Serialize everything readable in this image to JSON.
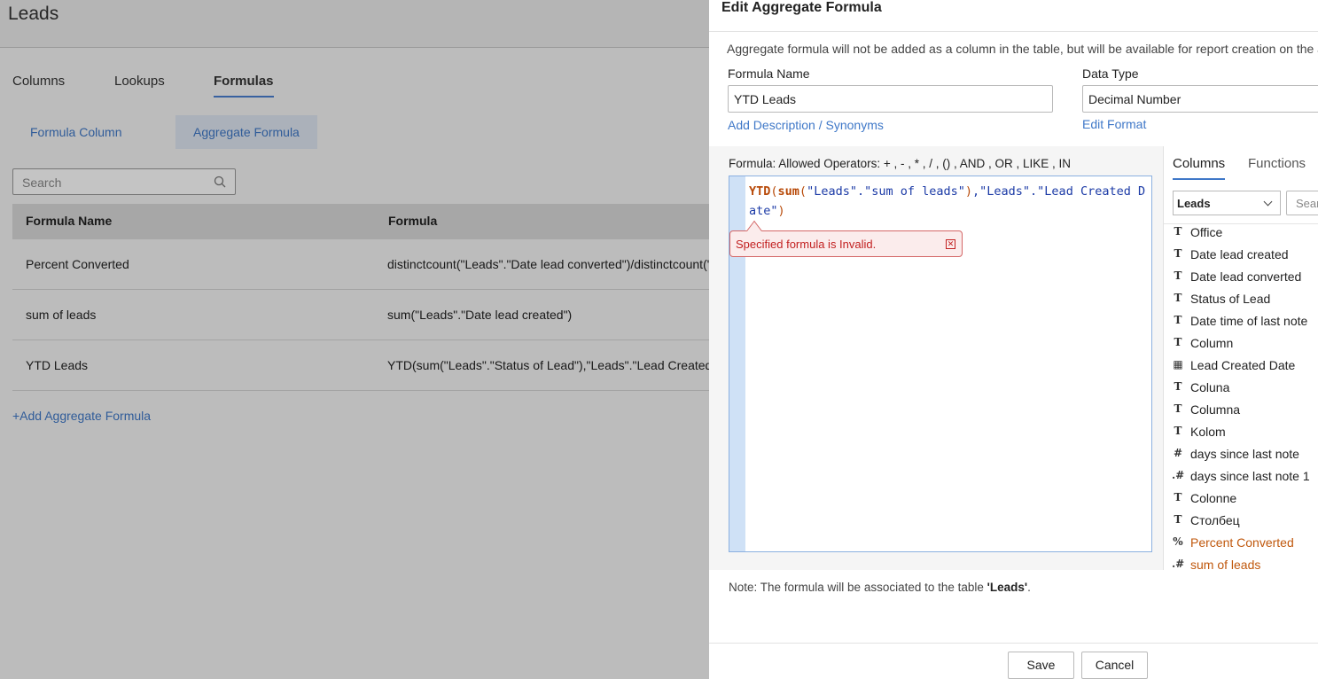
{
  "background": {
    "page_title": "Leads",
    "tabs": [
      "Columns",
      "Lookups",
      "Formulas"
    ],
    "subtabs": [
      "Formula Column",
      "Aggregate Formula"
    ],
    "search_placeholder": "Search",
    "table_headers": [
      "Formula Name",
      "Formula"
    ],
    "rows": [
      {
        "name": "Percent Converted",
        "formula": "distinctcount(\"Leads\".\"Date lead converted\")/distinctcount(\""
      },
      {
        "name": "sum of leads",
        "formula": "sum(\"Leads\".\"Date lead created\")"
      },
      {
        "name": "YTD Leads",
        "formula": "YTD(sum(\"Leads\".\"Status of Lead\"),\"Leads\".\"Lead Created Da"
      }
    ],
    "add_link": "+Add Aggregate Formula"
  },
  "dialog": {
    "title": "Edit Aggregate Formula",
    "info": "Aggregate formula will not be added as a column in the table, but will be available for report creation on the ass",
    "formula_name_label": "Formula Name",
    "formula_name_value": "YTD Leads",
    "add_description": "Add Description / Synonyms",
    "data_type_label": "Data Type",
    "data_type_value": "Decimal Number",
    "edit_format": "Edit Format",
    "operators_label": "Formula: Allowed Operators: + , - , * , / , () , AND , OR , LIKE , IN",
    "code": {
      "fn1": "YTD",
      "p1": "(",
      "fn2": "sum",
      "p2": "(",
      "s1": "\"Leads\".\"sum of leads\"",
      "p3": ")",
      "comma": ",",
      "s2": "\"Leads\".\"Lead Created Date\"",
      "p4": ")"
    },
    "error": "Specified formula is Invalid.",
    "panel_tabs": [
      "Columns",
      "Functions"
    ],
    "table_select": "Leads",
    "panel_search": "Sear",
    "columns": [
      {
        "icon": "T",
        "name": "Office",
        "type": "text"
      },
      {
        "icon": "T",
        "name": "Date lead created",
        "type": "text"
      },
      {
        "icon": "T",
        "name": "Date lead converted",
        "type": "text"
      },
      {
        "icon": "T",
        "name": "Status of Lead",
        "type": "text"
      },
      {
        "icon": "T",
        "name": "Date time of last note",
        "type": "text"
      },
      {
        "icon": "T",
        "name": "Column",
        "type": "text"
      },
      {
        "icon": "▦",
        "name": "Lead Created Date",
        "type": "date"
      },
      {
        "icon": "T",
        "name": "Coluna",
        "type": "text"
      },
      {
        "icon": "T",
        "name": "Columna",
        "type": "text"
      },
      {
        "icon": "T",
        "name": "Kolom",
        "type": "text"
      },
      {
        "icon": "#",
        "name": "days since last note",
        "type": "number"
      },
      {
        "icon": ".#",
        "name": "days since last note 1",
        "type": "decimal"
      },
      {
        "icon": "T",
        "name": "Colonne",
        "type": "text"
      },
      {
        "icon": "T",
        "name": "Столбец",
        "type": "text"
      },
      {
        "icon": "%",
        "name": "Percent Converted",
        "type": "formula"
      },
      {
        "icon": ".#",
        "name": "sum of leads",
        "type": "formula"
      }
    ],
    "note_prefix": "Note: The formula will be associated to the table ",
    "note_table": "'Leads'",
    "note_suffix": ".",
    "save": "Save",
    "cancel": "Cancel"
  }
}
